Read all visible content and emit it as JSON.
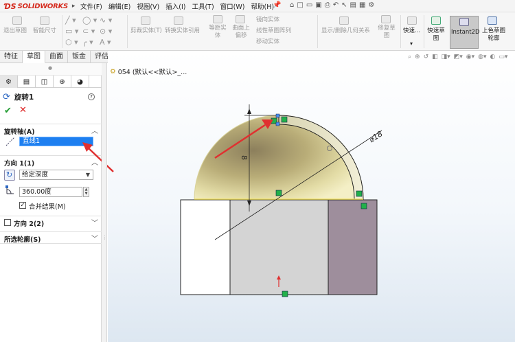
{
  "app": {
    "brand": "SOLIDWORKS"
  },
  "menu": [
    "文件(F)",
    "编辑(E)",
    "视图(V)",
    "插入(I)",
    "工具(T)",
    "窗口(W)",
    "帮助(H)"
  ],
  "ribbon": {
    "exit_sketch": "退出草图",
    "smart_dimension": "智能尺寸",
    "trim": "剪裁实体(T)",
    "convert": "转换实体引用",
    "offset": "等距实体",
    "offset_surface": "曲面上偏移",
    "mirror": "镜向实体",
    "linear_pattern": "线性草图阵列",
    "move": "移动实体",
    "display_delete": "显示/删除几何关系",
    "repair": "修复草图",
    "quick_snaps": "快速...",
    "rapid_sketch": "快速草图",
    "instant2d": "Instant2D",
    "shaded_contours": "上色草图轮廓"
  },
  "tabs": [
    "特征",
    "草图",
    "曲面",
    "钣金",
    "评估"
  ],
  "active_tab": "草图",
  "tree": {
    "item": "054 (默认<<默认>_..."
  },
  "pm": {
    "title": "旋转1",
    "axis_section": "旋转轴(A)",
    "axis_value": "直线1",
    "dir1_section": "方向 1(1)",
    "end_condition": "给定深度",
    "angle": "360.00度",
    "merge_label": "合并结果(M)",
    "merge_checked": true,
    "dir2_section": "方向 2(2)",
    "contours_section": "所选轮廓(S)"
  },
  "sketch": {
    "dim_vertical": "8",
    "dim_diameter": "⌀18"
  },
  "colors": {
    "arrow": "#e03030",
    "selection_blue": "#1e7ff0",
    "dome_yellow": "#e8e2a8",
    "right_block": "#9e8e9c",
    "center_block": "#d4d4d4",
    "relation_green": "#22b04a",
    "brand_red": "#d52b1e"
  }
}
